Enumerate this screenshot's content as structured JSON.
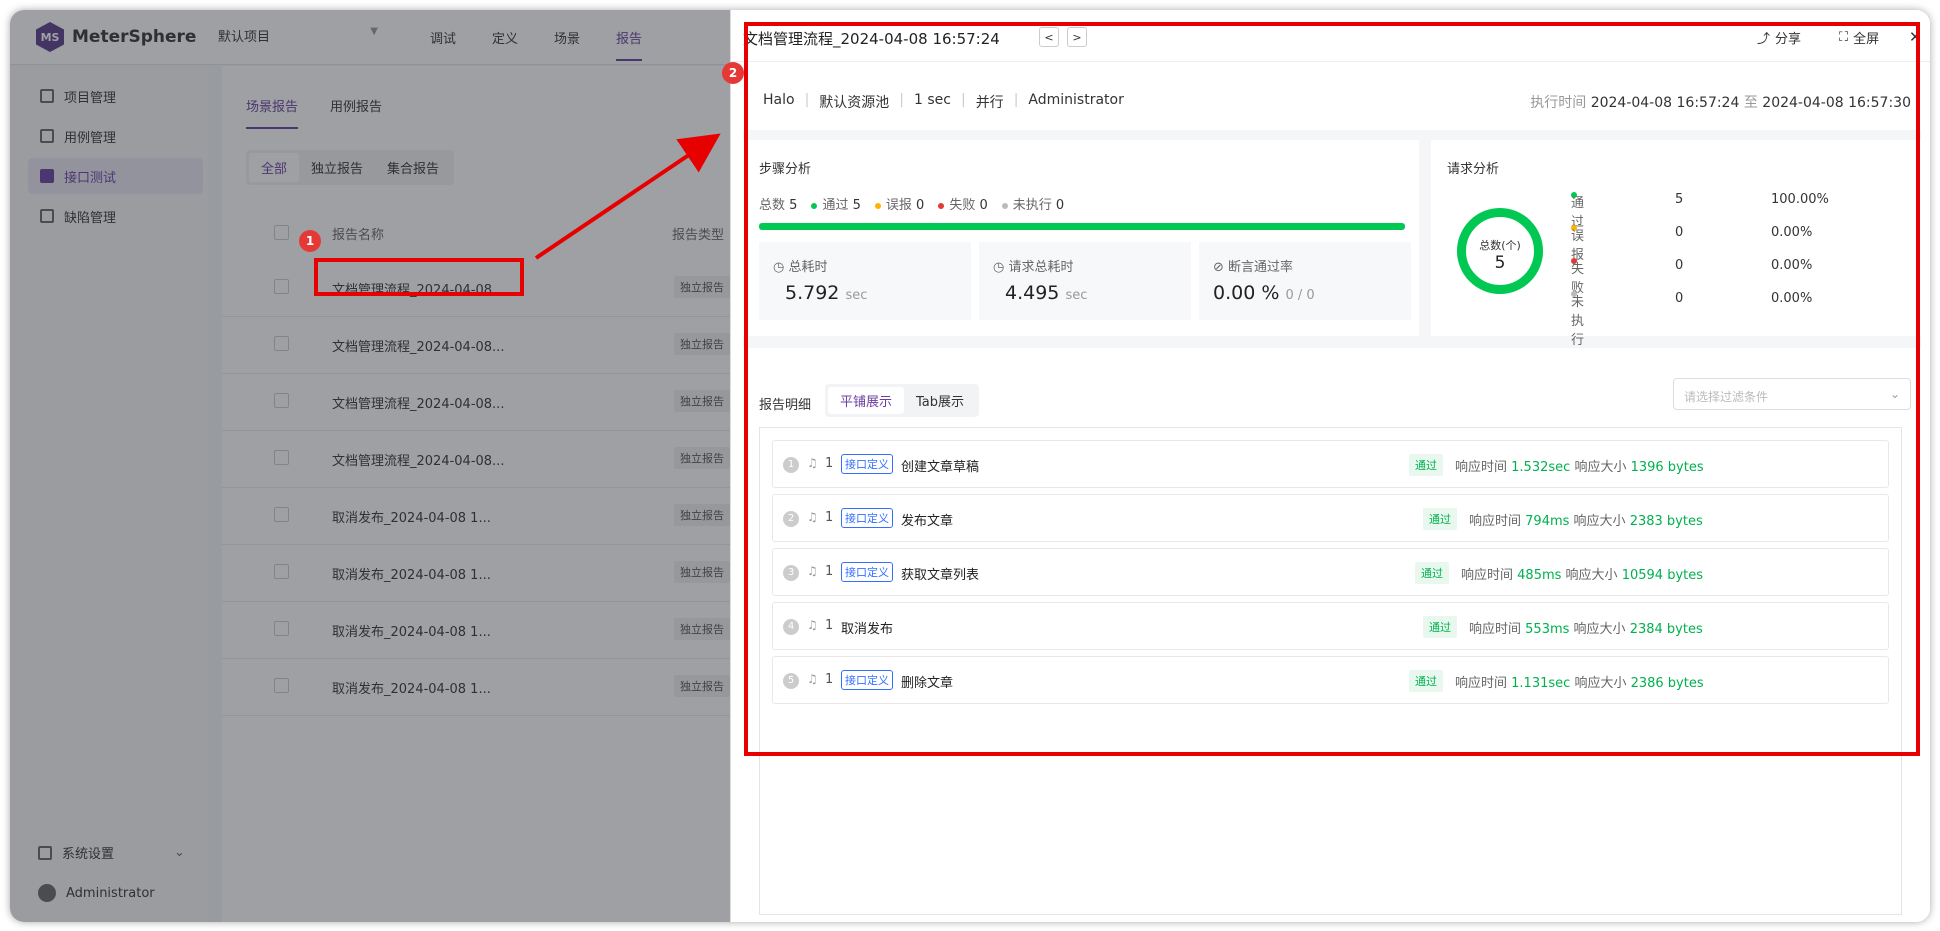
{
  "app": {
    "logo": "MeterSphere",
    "project": "默认项目",
    "topnav": [
      "调试",
      "定义",
      "场景",
      "报告"
    ],
    "sidebar": [
      "项目管理",
      "用例管理",
      "接口测试",
      "缺陷管理"
    ],
    "settings": "系统设置",
    "user": "Administrator"
  },
  "list": {
    "tabs": [
      "场景报告",
      "用例报告"
    ],
    "filters": [
      "全部",
      "独立报告",
      "集合报告"
    ],
    "col_name": "报告名称",
    "col_type": "报告类型",
    "rows": [
      {
        "name": "文档管理流程_2024-04-08...",
        "type": "独立报告"
      },
      {
        "name": "文档管理流程_2024-04-08...",
        "type": "独立报告"
      },
      {
        "name": "文档管理流程_2024-04-08...",
        "type": "独立报告"
      },
      {
        "name": "文档管理流程_2024-04-08...",
        "type": "独立报告"
      },
      {
        "name": "取消发布_2024-04-08 1...",
        "type": "独立报告"
      },
      {
        "name": "取消发布_2024-04-08 1...",
        "type": "独立报告"
      },
      {
        "name": "取消发布_2024-04-08 1...",
        "type": "独立报告"
      },
      {
        "name": "取消发布_2024-04-08 1...",
        "type": "独立报告"
      }
    ]
  },
  "drawer": {
    "title": "文档管理流程_2024-04-08 16:57:24",
    "share": "分享",
    "fullscreen": "全屏",
    "meta": [
      "Halo",
      "默认资源池",
      "1 sec",
      "并行",
      "Administrator"
    ],
    "exec_label": "执行时间",
    "exec_start": "2024-04-08 16:57:24",
    "exec_to": "至",
    "exec_end": "2024-04-08 16:57:30",
    "step_title": "步骤分析",
    "step_legend": {
      "total": "总数",
      "total_v": "5",
      "pass": "通过",
      "pass_v": "5",
      "false_alarm": "误报",
      "false_alarm_v": "0",
      "fail": "失败",
      "fail_v": "0",
      "pending": "未执行",
      "pending_v": "0"
    },
    "stats": {
      "total_time_label": "总耗时",
      "total_time": "5.792",
      "total_time_unit": "sec",
      "req_time_label": "请求总耗时",
      "req_time": "4.495",
      "req_time_unit": "sec",
      "assert_label": "断言通过率",
      "assert_rate": "0.00 %",
      "assert_frac": "0 / 0"
    },
    "req_title": "请求分析",
    "donut": {
      "label": "总数(个)",
      "value": "5"
    },
    "req_stats": [
      {
        "label": "通过",
        "count": "5",
        "pct": "100.00%",
        "color": "#00c853"
      },
      {
        "label": "误报",
        "count": "0",
        "pct": "0.00%",
        "color": "#ffb300"
      },
      {
        "label": "失败",
        "count": "0",
        "pct": "0.00%",
        "color": "#e53935"
      },
      {
        "label": "未执行",
        "count": "0",
        "pct": "0.00%",
        "color": "#bbbbbb"
      }
    ],
    "detail_title": "报告明细",
    "toggle": [
      "平铺展示",
      "Tab展示"
    ],
    "filter_placeholder": "请选择过滤条件",
    "tag": "接口定义",
    "pass": "通过",
    "resp_time_label": "响应时间",
    "resp_size_label": "响应大小",
    "steps": [
      {
        "no": "1",
        "count": "1",
        "tag": true,
        "name": "创建文章草稿",
        "time": "1.532sec",
        "size": "1396 bytes"
      },
      {
        "no": "2",
        "count": "1",
        "tag": true,
        "name": "发布文章",
        "time": "794ms",
        "size": "2383 bytes"
      },
      {
        "no": "3",
        "count": "1",
        "tag": true,
        "name": "获取文章列表",
        "time": "485ms",
        "size": "10594 bytes"
      },
      {
        "no": "4",
        "count": "1",
        "tag": false,
        "name": "取消发布",
        "time": "553ms",
        "size": "2384 bytes"
      },
      {
        "no": "5",
        "count": "1",
        "tag": true,
        "name": "删除文章",
        "time": "1.131sec",
        "size": "2386 bytes"
      }
    ]
  },
  "annotations": [
    "1",
    "2"
  ]
}
